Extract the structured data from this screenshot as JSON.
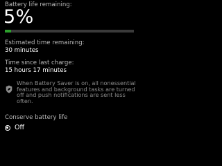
{
  "battery": {
    "label": "Battery life remaining:",
    "percent_text": "5%",
    "level": 0.05,
    "bar_color": "#2ca02c",
    "track_color": "#3a3a3a"
  },
  "estimate": {
    "label": "Estimated time remaining:",
    "value": "30 minutes"
  },
  "since_charge": {
    "label": "Time since last charge:",
    "value": "15 hours 17 minutes"
  },
  "saver_note": {
    "icon": "shield-leaf-icon",
    "text": "When Battery Saver is on, all nonessential features and background tasks are turned off and push notifications are sent less often."
  },
  "conserve": {
    "label": "Conserve battery life",
    "state": "Off"
  },
  "colors": {
    "background": "#000000",
    "text": "#ffffff",
    "dim_text": "#b9b9b9",
    "note_text": "#8c8c8c"
  }
}
